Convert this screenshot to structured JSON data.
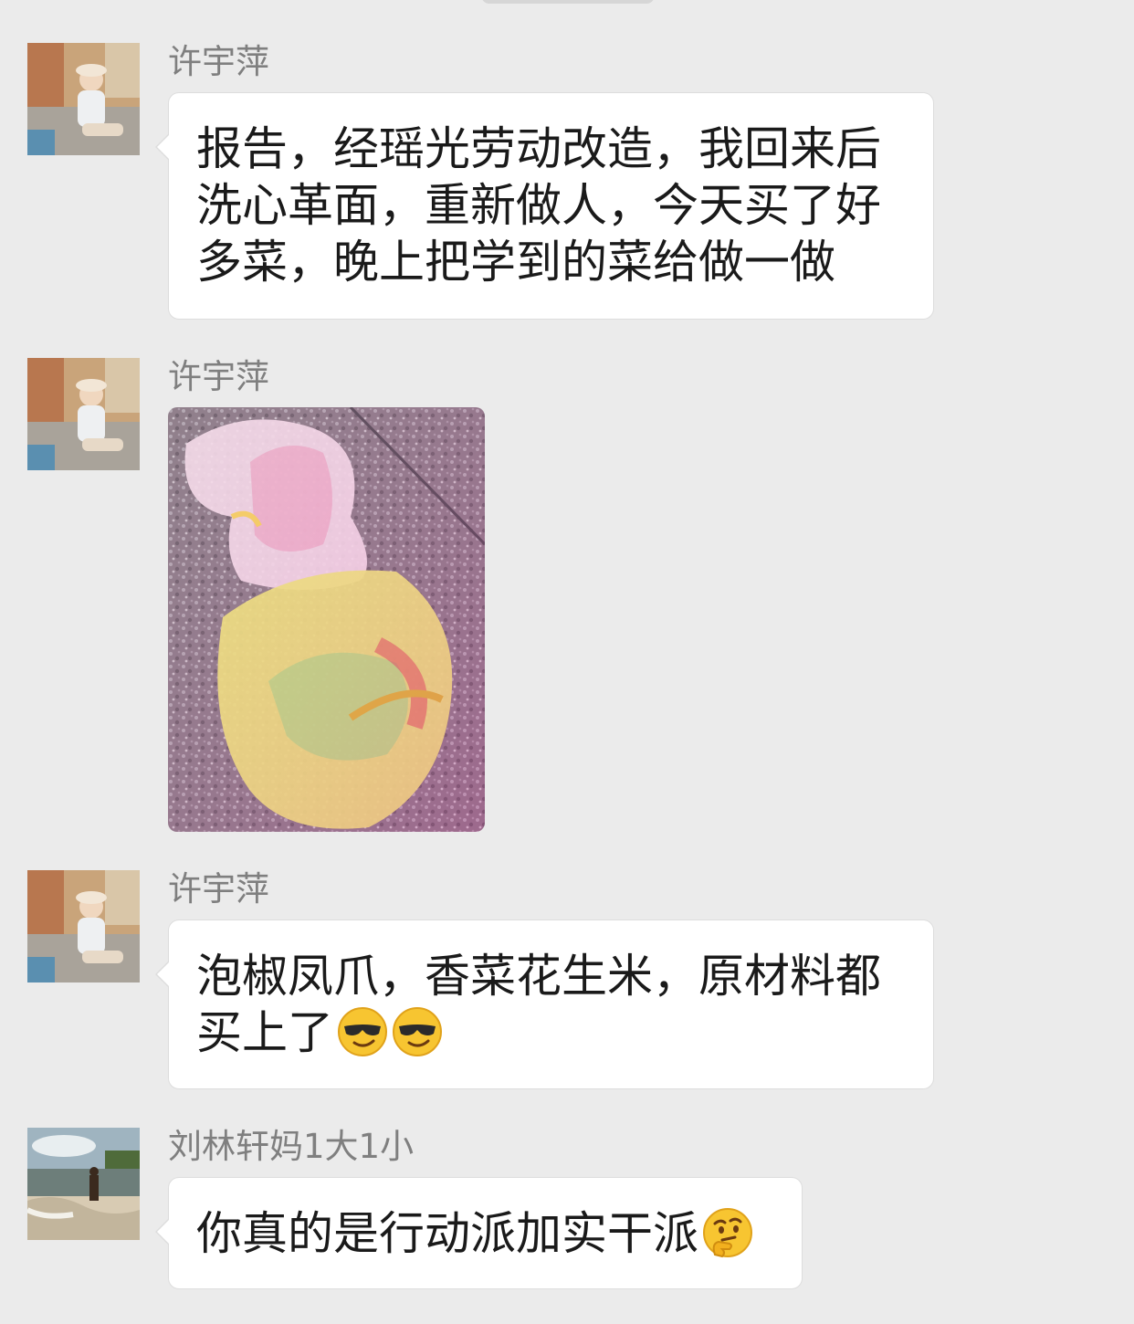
{
  "messages": [
    {
      "sender": "许宇萍",
      "type": "text",
      "text": "报告，经瑶光劳动改造，我回来后洗心革面，重新做人，今天买了好多菜，晚上把学到的菜给做一做"
    },
    {
      "sender": "许宇萍",
      "type": "image",
      "image_desc": "photo"
    },
    {
      "sender": "许宇萍",
      "type": "text",
      "text": "泡椒凤爪，香菜花生米，原材料都买上了",
      "emojis": [
        "cool-face-emoji",
        "cool-face-emoji"
      ]
    },
    {
      "sender": "刘林轩妈1大1小",
      "type": "text",
      "text": "你真的是行动派加实干派",
      "emojis": [
        "thinking-face-emoji"
      ]
    }
  ]
}
